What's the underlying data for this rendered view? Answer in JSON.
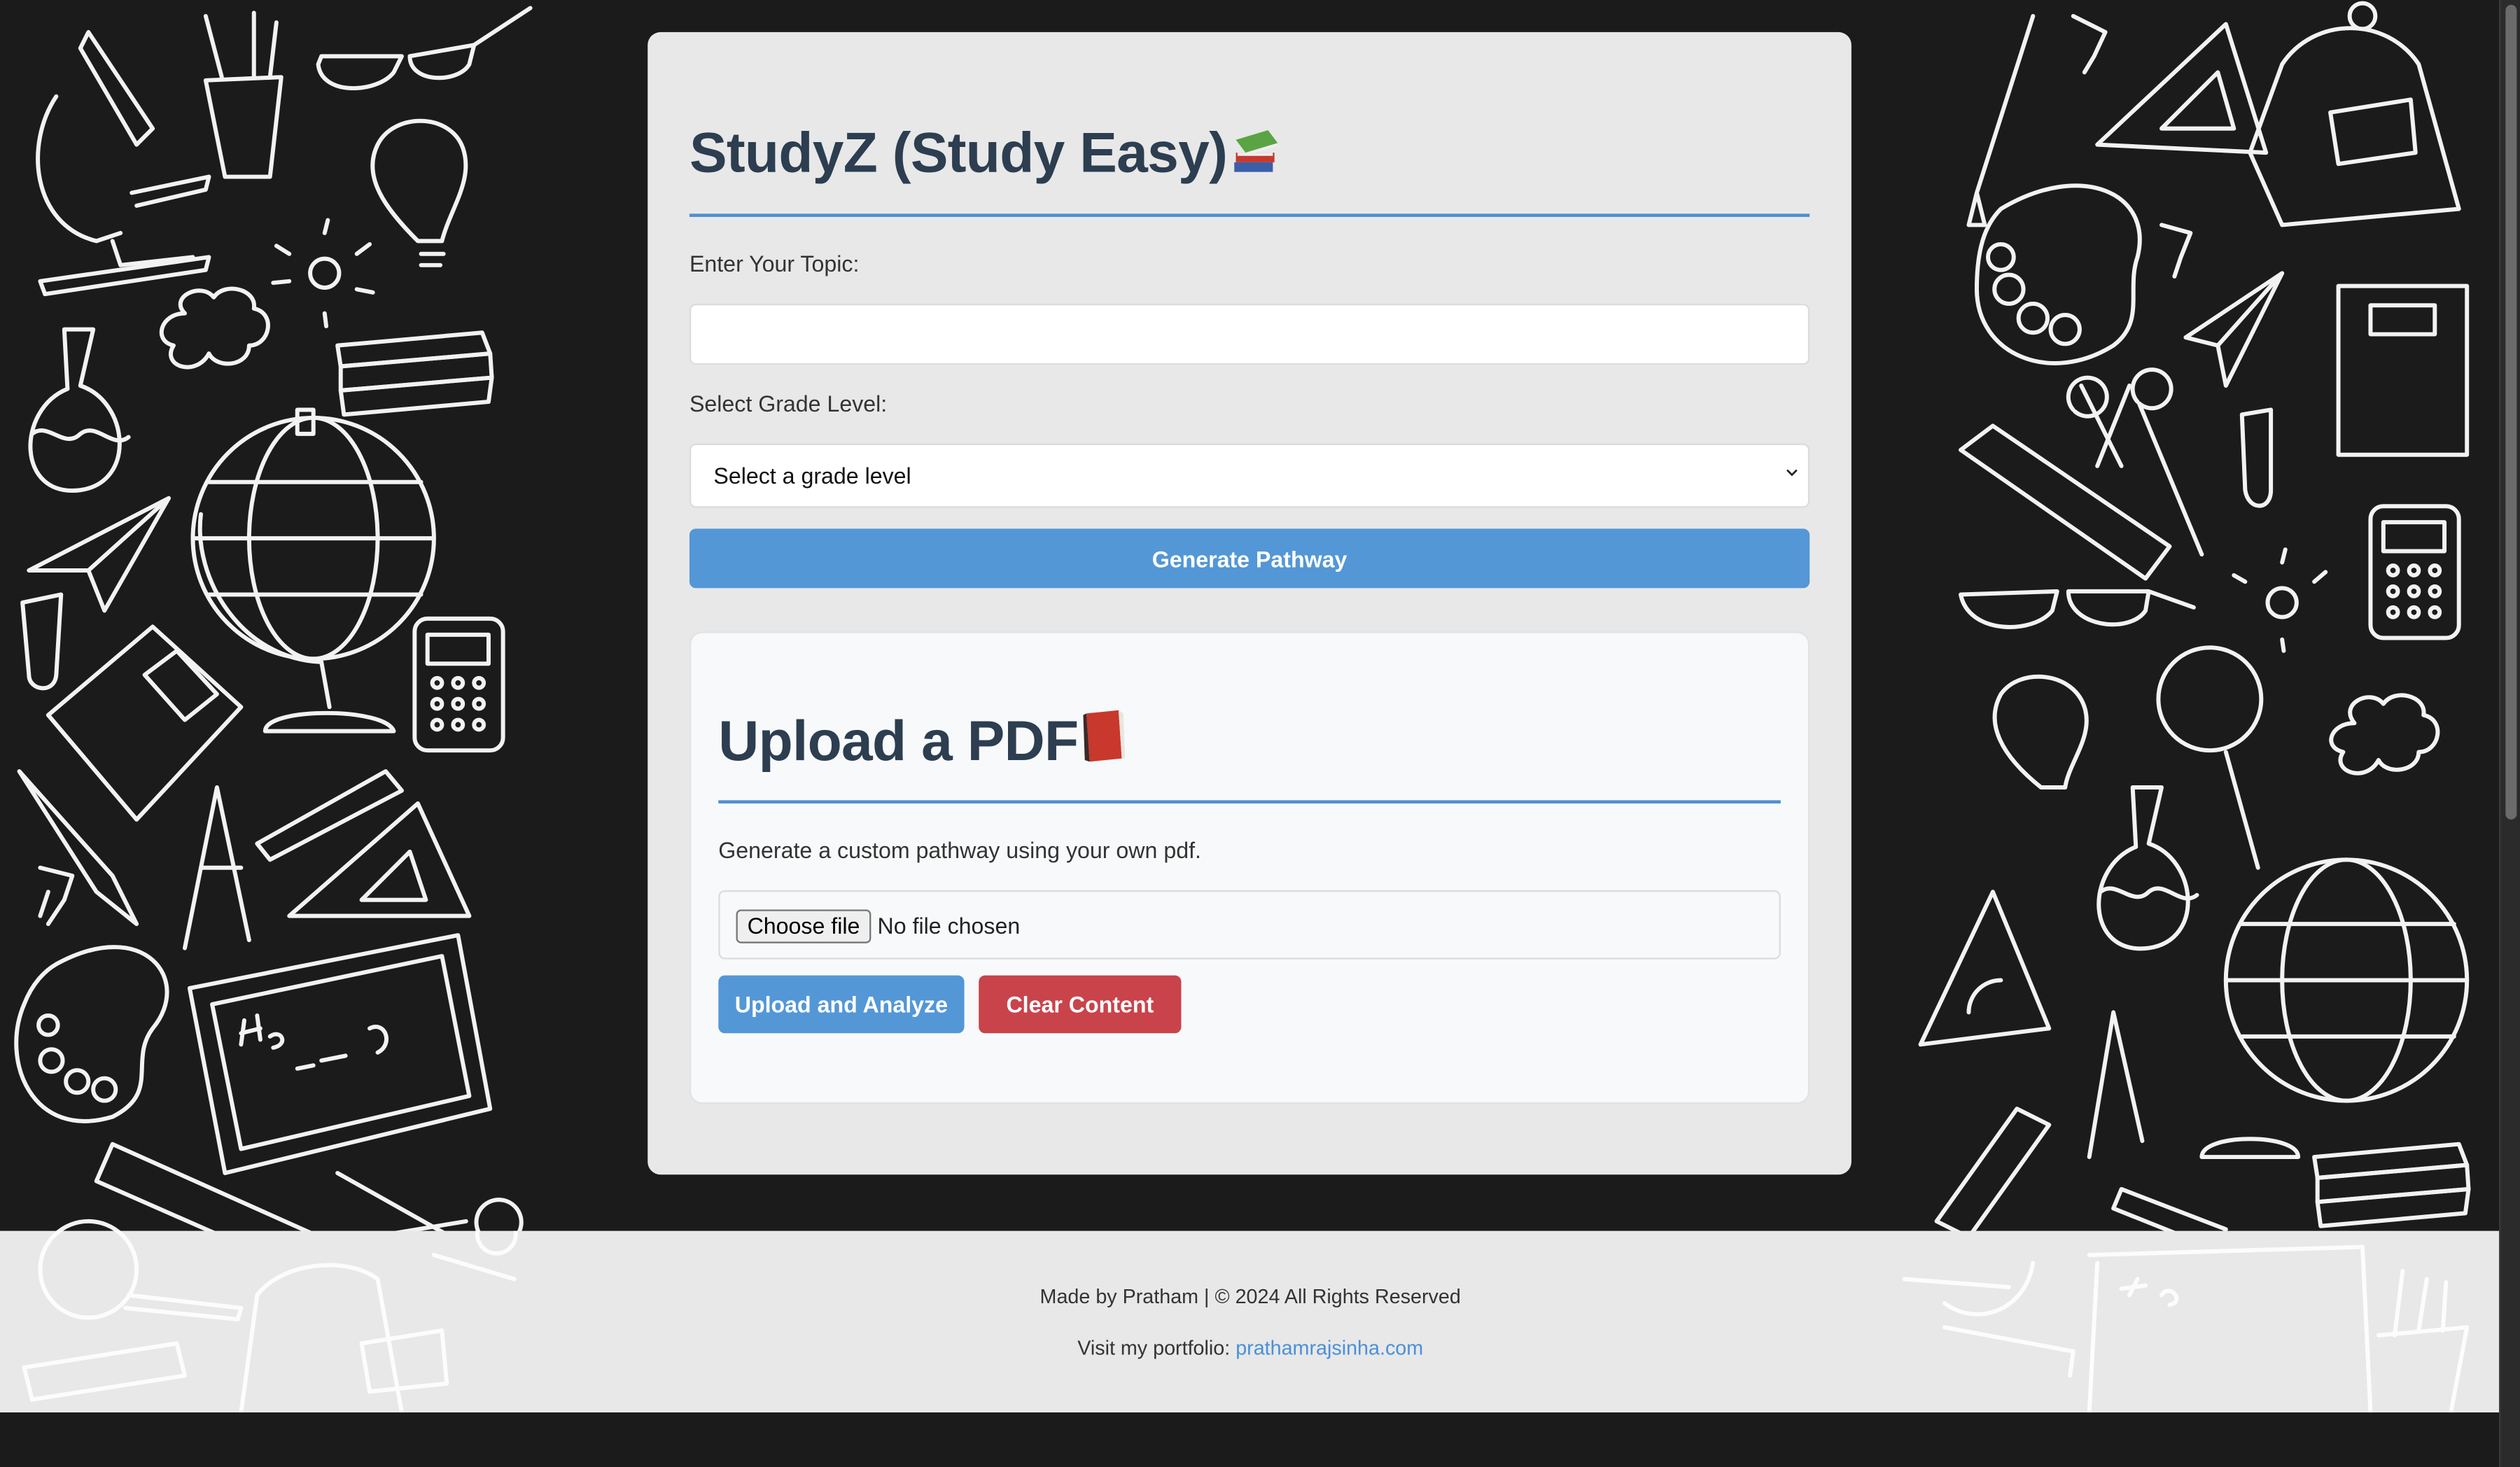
{
  "app": {
    "title": "StudyZ (Study Easy)",
    "title_icon": "books-icon"
  },
  "form": {
    "topic_label": "Enter Your Topic:",
    "topic_value": "",
    "topic_placeholder": "",
    "grade_label": "Select Grade Level:",
    "grade_selected": "Select a grade level",
    "generate_button": "Generate Pathway"
  },
  "upload": {
    "heading": "Upload a PDF",
    "heading_icon": "red-book-icon",
    "description": "Generate a custom pathway using your own pdf.",
    "choose_file_button": "Choose file",
    "file_status": "No file chosen",
    "upload_button": "Upload and Analyze",
    "clear_button": "Clear Content"
  },
  "footer": {
    "credit": "Made by Pratham | © 2024 All Rights Reserved",
    "portfolio_prefix": "Visit my portfolio: ",
    "portfolio_link": "prathamrajsinha.com"
  },
  "colors": {
    "background": "#1b1b1b",
    "card": "#e8e8e8",
    "heading": "#2c3e50",
    "accent_blue": "#5397d6",
    "danger_red": "#c9434b",
    "link": "#4a90d9"
  }
}
